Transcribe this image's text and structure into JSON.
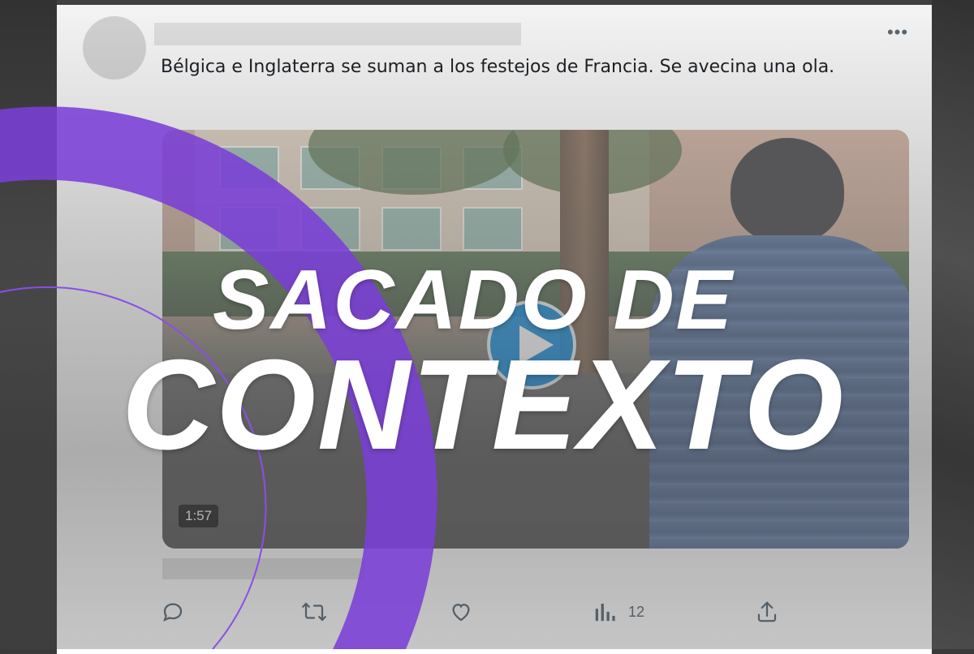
{
  "tweet": {
    "text": "Bélgica e Inglaterra se suman a los festejos de Francia. Se avecina una ola.",
    "more_icon": "more-horizontal-icon",
    "video": {
      "duration": "1:57",
      "play_icon": "play-icon"
    },
    "actions": {
      "reply_icon": "reply-icon",
      "retweet_icon": "retweet-icon",
      "like_icon": "heart-icon",
      "views_icon": "bar-chart-icon",
      "views_count": "12",
      "share_icon": "share-icon"
    }
  },
  "stamp": {
    "line1": "SACADO DE",
    "line2": "CONTEXTO"
  },
  "colors": {
    "accent_purple": "#7a3fd6",
    "play_blue": "#1d9bf0",
    "icon_gray": "#536471"
  }
}
